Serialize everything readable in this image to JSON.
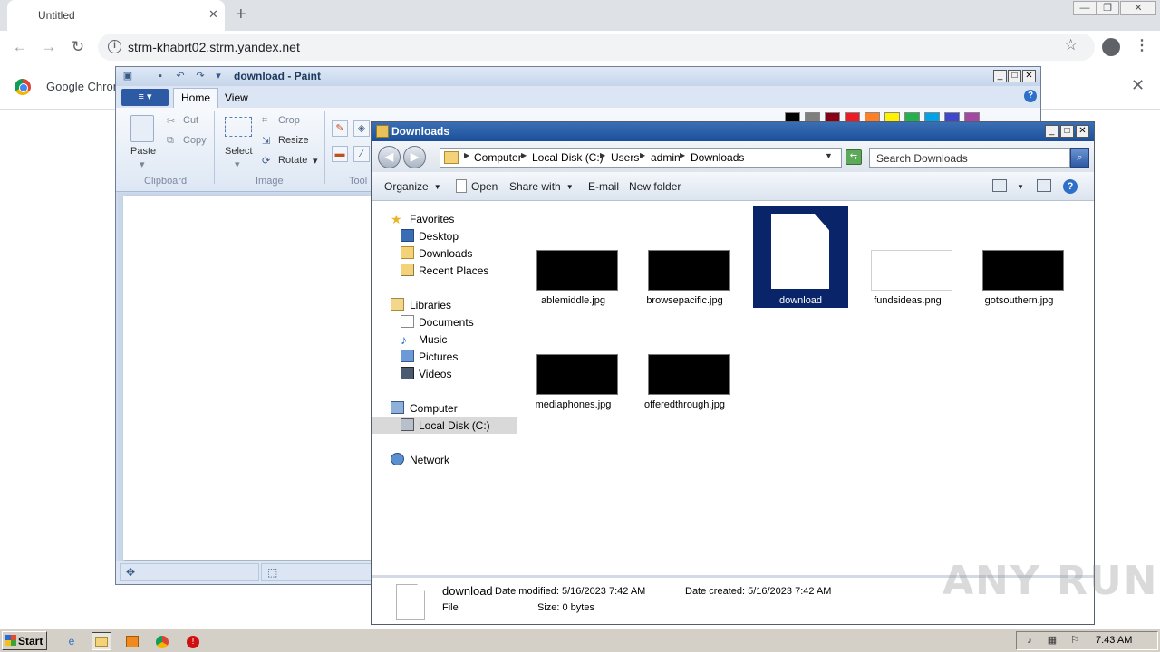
{
  "chrome": {
    "tab_title": "Untitled",
    "tab_close": "✕",
    "new_tab": "+",
    "back": "←",
    "forward": "→",
    "reload": "↻",
    "info": "i",
    "url": "strm-khabrt02.strm.yandex.net",
    "star": "☆",
    "menu": "⋮",
    "infobar_text": "Google Chrom",
    "infobar_close": "✕",
    "minimize": "—",
    "restore": "❐",
    "close": "✕"
  },
  "paint": {
    "title": "download - Paint",
    "tabs": {
      "home": "Home",
      "view": "View"
    },
    "help": "?",
    "window_controls": {
      "minimize": "_",
      "maximize": "□",
      "close": "✕"
    },
    "clipboard": {
      "paste": "Paste",
      "cut": "Cut",
      "copy": "Copy",
      "group": "Clipboard"
    },
    "image": {
      "select": "Select",
      "crop": "Crop",
      "resize": "Resize",
      "rotate": "Rotate",
      "group": "Image"
    },
    "tools_group": "Tool",
    "palette": [
      "#000000",
      "#7f7f7f",
      "#880015",
      "#ed1c24",
      "#ff7f27",
      "#fff200",
      "#22b14c",
      "#00a2e8",
      "#3f48cc",
      "#a349a4"
    ]
  },
  "explorer": {
    "title": "Downloads",
    "window_controls": {
      "minimize": "_",
      "maximize": "□",
      "close": "✕"
    },
    "back": "◀",
    "forward": "▶",
    "breadcrumb": [
      "Computer",
      "Local Disk (C:)",
      "Users",
      "admin",
      "Downloads"
    ],
    "search_placeholder": "Search Downloads",
    "commands": {
      "organize": "Organize",
      "open": "Open",
      "share_with": "Share with",
      "email": "E-mail",
      "new_folder": "New folder"
    },
    "help": "?",
    "nav": {
      "favorites": "Favorites",
      "desktop": "Desktop",
      "downloads": "Downloads",
      "recent_places": "Recent Places",
      "libraries": "Libraries",
      "documents": "Documents",
      "music": "Music",
      "pictures": "Pictures",
      "videos": "Videos",
      "computer": "Computer",
      "local_disk": "Local Disk (C:)",
      "network": "Network"
    },
    "files": [
      {
        "name": "ablemiddle.jpg"
      },
      {
        "name": "browsepacific.jpg"
      },
      {
        "name": "download"
      },
      {
        "name": "fundsideas.png"
      },
      {
        "name": "gotsouthern.jpg"
      },
      {
        "name": "mediaphones.jpg"
      },
      {
        "name": "offeredthrough.jpg"
      }
    ],
    "details": {
      "name": "download",
      "type": "File",
      "date_modified": "Date modified: 5/16/2023 7:42 AM",
      "date_created": "Date created: 5/16/2023 7:42 AM",
      "size": "Size: 0 bytes"
    }
  },
  "watermark": "ANY RUN",
  "taskbar": {
    "start": "Start",
    "clock": "7:43 AM"
  }
}
